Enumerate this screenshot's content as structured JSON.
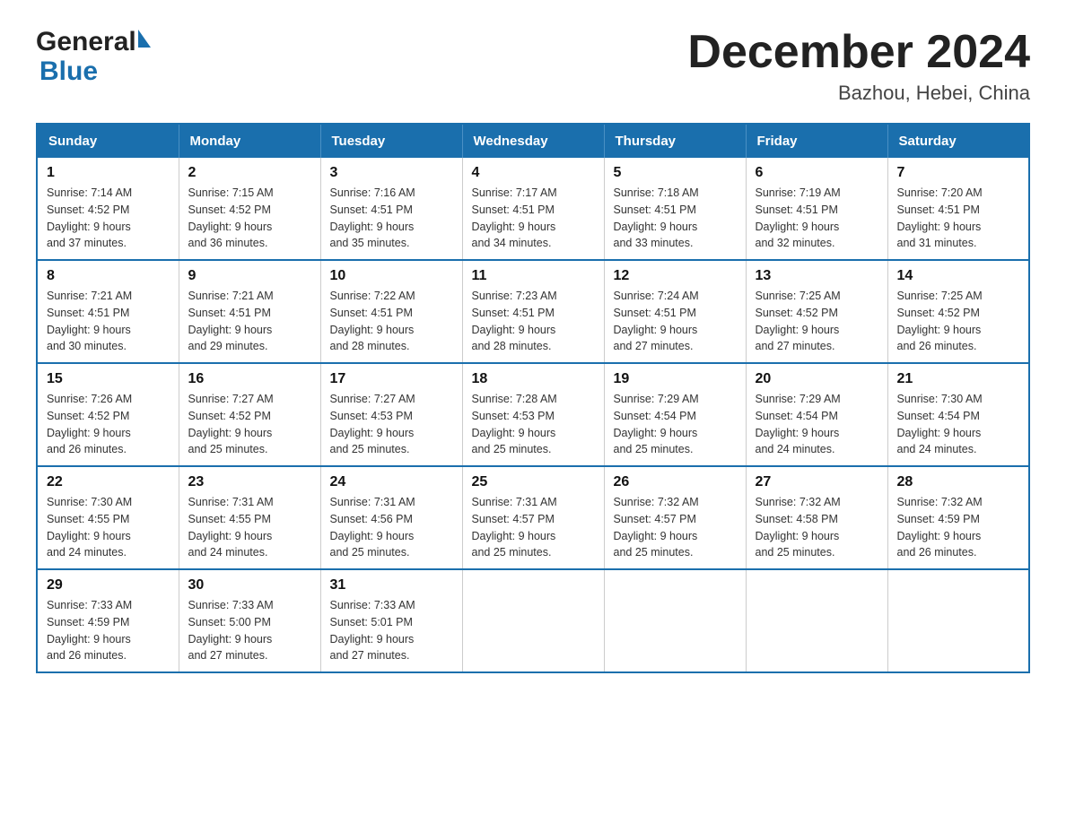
{
  "header": {
    "logo_general": "General",
    "logo_blue": "Blue",
    "main_title": "December 2024",
    "subtitle": "Bazhou, Hebei, China"
  },
  "days_of_week": [
    "Sunday",
    "Monday",
    "Tuesday",
    "Wednesday",
    "Thursday",
    "Friday",
    "Saturday"
  ],
  "weeks": [
    [
      {
        "day": "1",
        "sunrise": "7:14 AM",
        "sunset": "4:52 PM",
        "daylight": "9 hours and 37 minutes."
      },
      {
        "day": "2",
        "sunrise": "7:15 AM",
        "sunset": "4:52 PM",
        "daylight": "9 hours and 36 minutes."
      },
      {
        "day": "3",
        "sunrise": "7:16 AM",
        "sunset": "4:51 PM",
        "daylight": "9 hours and 35 minutes."
      },
      {
        "day": "4",
        "sunrise": "7:17 AM",
        "sunset": "4:51 PM",
        "daylight": "9 hours and 34 minutes."
      },
      {
        "day": "5",
        "sunrise": "7:18 AM",
        "sunset": "4:51 PM",
        "daylight": "9 hours and 33 minutes."
      },
      {
        "day": "6",
        "sunrise": "7:19 AM",
        "sunset": "4:51 PM",
        "daylight": "9 hours and 32 minutes."
      },
      {
        "day": "7",
        "sunrise": "7:20 AM",
        "sunset": "4:51 PM",
        "daylight": "9 hours and 31 minutes."
      }
    ],
    [
      {
        "day": "8",
        "sunrise": "7:21 AM",
        "sunset": "4:51 PM",
        "daylight": "9 hours and 30 minutes."
      },
      {
        "day": "9",
        "sunrise": "7:21 AM",
        "sunset": "4:51 PM",
        "daylight": "9 hours and 29 minutes."
      },
      {
        "day": "10",
        "sunrise": "7:22 AM",
        "sunset": "4:51 PM",
        "daylight": "9 hours and 28 minutes."
      },
      {
        "day": "11",
        "sunrise": "7:23 AM",
        "sunset": "4:51 PM",
        "daylight": "9 hours and 28 minutes."
      },
      {
        "day": "12",
        "sunrise": "7:24 AM",
        "sunset": "4:51 PM",
        "daylight": "9 hours and 27 minutes."
      },
      {
        "day": "13",
        "sunrise": "7:25 AM",
        "sunset": "4:52 PM",
        "daylight": "9 hours and 27 minutes."
      },
      {
        "day": "14",
        "sunrise": "7:25 AM",
        "sunset": "4:52 PM",
        "daylight": "9 hours and 26 minutes."
      }
    ],
    [
      {
        "day": "15",
        "sunrise": "7:26 AM",
        "sunset": "4:52 PM",
        "daylight": "9 hours and 26 minutes."
      },
      {
        "day": "16",
        "sunrise": "7:27 AM",
        "sunset": "4:52 PM",
        "daylight": "9 hours and 25 minutes."
      },
      {
        "day": "17",
        "sunrise": "7:27 AM",
        "sunset": "4:53 PM",
        "daylight": "9 hours and 25 minutes."
      },
      {
        "day": "18",
        "sunrise": "7:28 AM",
        "sunset": "4:53 PM",
        "daylight": "9 hours and 25 minutes."
      },
      {
        "day": "19",
        "sunrise": "7:29 AM",
        "sunset": "4:54 PM",
        "daylight": "9 hours and 25 minutes."
      },
      {
        "day": "20",
        "sunrise": "7:29 AM",
        "sunset": "4:54 PM",
        "daylight": "9 hours and 24 minutes."
      },
      {
        "day": "21",
        "sunrise": "7:30 AM",
        "sunset": "4:54 PM",
        "daylight": "9 hours and 24 minutes."
      }
    ],
    [
      {
        "day": "22",
        "sunrise": "7:30 AM",
        "sunset": "4:55 PM",
        "daylight": "9 hours and 24 minutes."
      },
      {
        "day": "23",
        "sunrise": "7:31 AM",
        "sunset": "4:55 PM",
        "daylight": "9 hours and 24 minutes."
      },
      {
        "day": "24",
        "sunrise": "7:31 AM",
        "sunset": "4:56 PM",
        "daylight": "9 hours and 25 minutes."
      },
      {
        "day": "25",
        "sunrise": "7:31 AM",
        "sunset": "4:57 PM",
        "daylight": "9 hours and 25 minutes."
      },
      {
        "day": "26",
        "sunrise": "7:32 AM",
        "sunset": "4:57 PM",
        "daylight": "9 hours and 25 minutes."
      },
      {
        "day": "27",
        "sunrise": "7:32 AM",
        "sunset": "4:58 PM",
        "daylight": "9 hours and 25 minutes."
      },
      {
        "day": "28",
        "sunrise": "7:32 AM",
        "sunset": "4:59 PM",
        "daylight": "9 hours and 26 minutes."
      }
    ],
    [
      {
        "day": "29",
        "sunrise": "7:33 AM",
        "sunset": "4:59 PM",
        "daylight": "9 hours and 26 minutes."
      },
      {
        "day": "30",
        "sunrise": "7:33 AM",
        "sunset": "5:00 PM",
        "daylight": "9 hours and 27 minutes."
      },
      {
        "day": "31",
        "sunrise": "7:33 AM",
        "sunset": "5:01 PM",
        "daylight": "9 hours and 27 minutes."
      },
      null,
      null,
      null,
      null
    ]
  ],
  "labels": {
    "sunrise": "Sunrise:",
    "sunset": "Sunset:",
    "daylight": "Daylight:"
  }
}
